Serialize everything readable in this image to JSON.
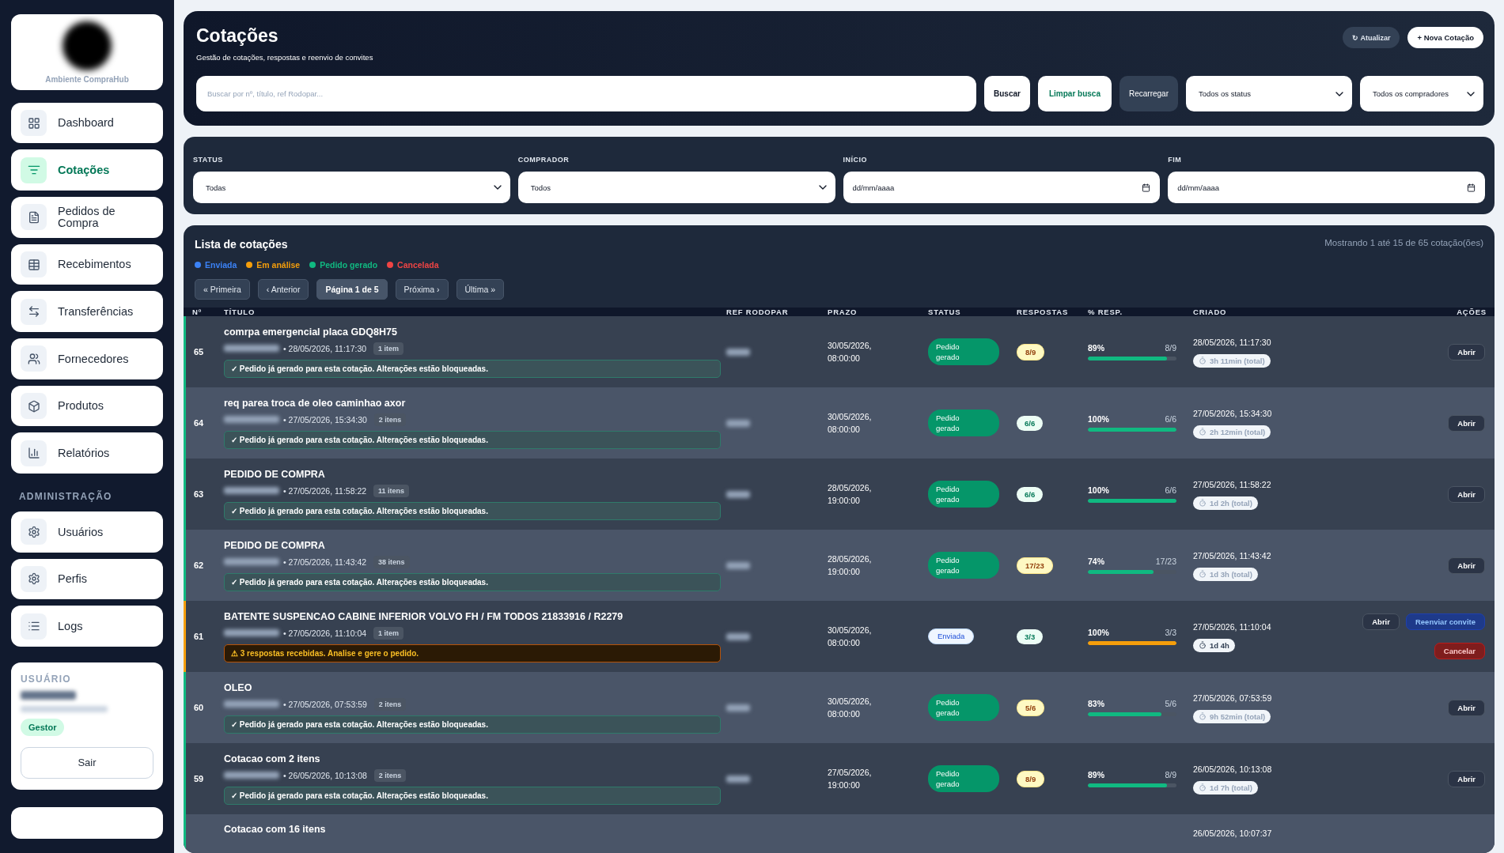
{
  "sidebar": {
    "logo_caption": "Ambiente CompraHub",
    "items": [
      {
        "label": "Dashboard",
        "selected": false
      },
      {
        "label": "Cotações",
        "selected": true
      },
      {
        "label": "Pedidos de Compra",
        "selected": false
      },
      {
        "label": "Recebimentos",
        "selected": false
      },
      {
        "label": "Transferências",
        "selected": false
      },
      {
        "label": "Fornecedores",
        "selected": false
      },
      {
        "label": "Produtos",
        "selected": false
      },
      {
        "label": "Relatórios",
        "selected": false
      }
    ],
    "admin_title": "ADMINISTRAÇÃO",
    "admin_items": [
      {
        "label": "Usuários",
        "selected": false
      },
      {
        "label": "Perfis",
        "selected": false
      },
      {
        "label": "Logs",
        "selected": false
      }
    ],
    "user": {
      "title": "USUÁRIO",
      "role": "Gestor",
      "logout": "Sair"
    }
  },
  "header": {
    "title": "Cotações",
    "subtitle": "Gestão de cotações, respostas e reenvio de convites",
    "refresh": "↻ Atualizar",
    "new": "+ Nova Cotação",
    "search": {
      "placeholder": "Buscar por nº, título, ref Rodopar..."
    },
    "search_button": "Buscar",
    "clear_button": "Limpar busca",
    "reload_button": "Recarregar",
    "status_select": "Todos os status",
    "buyer_select": "Todos os compradores"
  },
  "filters": [
    {
      "label": "STATUS",
      "kind": "select",
      "value": "Todas"
    },
    {
      "label": "COMPRADOR",
      "kind": "select",
      "value": "Todos"
    },
    {
      "label": "INÍCIO",
      "kind": "date",
      "value": "dd/mm/aaaa"
    },
    {
      "label": "FIM",
      "kind": "date",
      "value": "dd/mm/aaaa"
    }
  ],
  "list": {
    "title": "Lista de cotações",
    "summary": "Mostrando 1 até 15 de 65 cotação(ões)",
    "legend": [
      {
        "label": "Enviada",
        "color": "#3b82f6"
      },
      {
        "label": "Em análise",
        "color": "#f59e0b"
      },
      {
        "label": "Pedido gerado",
        "color": "#10b981"
      },
      {
        "label": "Cancelada",
        "color": "#ef4444"
      }
    ],
    "pagination": [
      {
        "label": "« Primeira",
        "selected": false
      },
      {
        "label": "‹ Anterior",
        "selected": false
      },
      {
        "label": "Página 1 de 5",
        "selected": true
      },
      {
        "label": "Próxima ›",
        "selected": false
      },
      {
        "label": "Última »",
        "selected": false
      }
    ],
    "columns": [
      "Nº",
      "TÍTULO",
      "REF RODOPAR",
      "PRAZO",
      "STATUS",
      "RESPOSTAS",
      "% RESP.",
      "CRIADO",
      "AÇÕES"
    ],
    "rows": [
      {
        "number": "65",
        "title": "comrpa emergencial placa GDQ8H75",
        "date": "• 28/05/2026, 11:17:30",
        "items": "1 item",
        "notice": {
          "kind": "ok",
          "text": "✓ Pedido já gerado para esta cotação. Alterações estão bloqueadas."
        },
        "deadline": "30/05/2026, 08:00:00",
        "status": {
          "kind": "gerado",
          "label": "Pedido gerado"
        },
        "responses": "8/9",
        "complete": false,
        "percent": "89%",
        "level": 0.89,
        "ratio": "8/9",
        "created": "28/05/2026, 11:17:30",
        "duration": "3h 11min (total)",
        "final": true,
        "actions": [
          {
            "kind": "open",
            "label": "Abrir"
          }
        ]
      },
      {
        "number": "64",
        "title": "req parea troca de oleo caminhao axor",
        "date": "• 27/05/2026, 15:34:30",
        "items": "2 itens",
        "notice": {
          "kind": "ok",
          "text": "✓ Pedido já gerado para esta cotação. Alterações estão bloqueadas."
        },
        "deadline": "30/05/2026, 08:00:00",
        "status": {
          "kind": "gerado",
          "label": "Pedido gerado"
        },
        "responses": "6/6",
        "complete": true,
        "percent": "100%",
        "level": 1,
        "ratio": "6/6",
        "created": "27/05/2026, 15:34:30",
        "duration": "2h 12min (total)",
        "final": true,
        "actions": [
          {
            "kind": "open",
            "label": "Abrir"
          }
        ]
      },
      {
        "number": "63",
        "title": "PEDIDO DE COMPRA",
        "date": "• 27/05/2026, 11:58:22",
        "items": "11 itens",
        "notice": {
          "kind": "ok",
          "text": "✓ Pedido já gerado para esta cotação. Alterações estão bloqueadas."
        },
        "deadline": "28/05/2026, 19:00:00",
        "status": {
          "kind": "gerado",
          "label": "Pedido gerado"
        },
        "responses": "6/6",
        "complete": true,
        "percent": "100%",
        "level": 1,
        "ratio": "6/6",
        "created": "27/05/2026, 11:58:22",
        "duration": "1d 2h (total)",
        "final": true,
        "actions": [
          {
            "kind": "open",
            "label": "Abrir"
          }
        ]
      },
      {
        "number": "62",
        "title": "PEDIDO DE COMPRA",
        "date": "• 27/05/2026, 11:43:42",
        "items": "38 itens",
        "notice": {
          "kind": "ok",
          "text": "✓ Pedido já gerado para esta cotação. Alterações estão bloqueadas."
        },
        "deadline": "28/05/2026, 19:00:00",
        "status": {
          "kind": "gerado",
          "label": "Pedido gerado"
        },
        "responses": "17/23",
        "complete": false,
        "percent": "74%",
        "level": 0.74,
        "ratio": "17/23",
        "created": "27/05/2026, 11:43:42",
        "duration": "1d 3h (total)",
        "final": true,
        "actions": [
          {
            "kind": "open",
            "label": "Abrir"
          }
        ]
      },
      {
        "number": "61",
        "title": "BATENTE SUSPENCAO CABINE INFERIOR VOLVO FH / FM TODOS 21833916 / R2279",
        "date": "• 27/05/2026, 11:10:04",
        "items": "1 item",
        "notice": {
          "kind": "warning",
          "text": "⚠ 3 respostas recebidas. Analise e gere o pedido."
        },
        "deadline": "30/05/2026, 08:00:00",
        "status": {
          "kind": "enviada",
          "label": "Enviada"
        },
        "responses": "3/3",
        "complete": true,
        "percent": "100%",
        "level": 1,
        "ratio": "3/3",
        "created": "27/05/2026, 11:10:04",
        "duration": "1d 4h",
        "final": false,
        "actions": [
          {
            "kind": "open",
            "label": "Abrir"
          },
          {
            "kind": "resend",
            "label": "Reenviar convite"
          },
          {
            "kind": "cancel",
            "label": "Cancelar"
          }
        ]
      },
      {
        "number": "60",
        "title": "OLEO",
        "date": "• 27/05/2026, 07:53:59",
        "items": "2 itens",
        "notice": {
          "kind": "ok",
          "text": "✓ Pedido já gerado para esta cotação. Alterações estão bloqueadas."
        },
        "deadline": "30/05/2026, 08:00:00",
        "status": {
          "kind": "gerado",
          "label": "Pedido gerado"
        },
        "responses": "5/6",
        "complete": false,
        "percent": "83%",
        "level": 0.83,
        "ratio": "5/6",
        "created": "27/05/2026, 07:53:59",
        "duration": "9h 52min (total)",
        "final": true,
        "actions": [
          {
            "kind": "open",
            "label": "Abrir"
          }
        ]
      },
      {
        "number": "59",
        "title": "Cotacao com 2 itens",
        "date": "• 26/05/2026, 10:13:08",
        "items": "2 itens",
        "notice": {
          "kind": "ok",
          "text": "✓ Pedido já gerado para esta cotação. Alterações estão bloqueadas."
        },
        "deadline": "27/05/2026, 19:00:00",
        "status": {
          "kind": "gerado",
          "label": "Pedido gerado"
        },
        "responses": "8/9",
        "complete": false,
        "percent": "89%",
        "level": 0.89,
        "ratio": "8/9",
        "created": "26/05/2026, 10:13:08",
        "duration": "1d 7h (total)",
        "final": true,
        "actions": [
          {
            "kind": "open",
            "label": "Abrir"
          }
        ]
      }
    ],
    "partial_row": {
      "title": "Cotacao com 16 itens",
      "created": "26/05/2026, 10:07:37"
    }
  }
}
